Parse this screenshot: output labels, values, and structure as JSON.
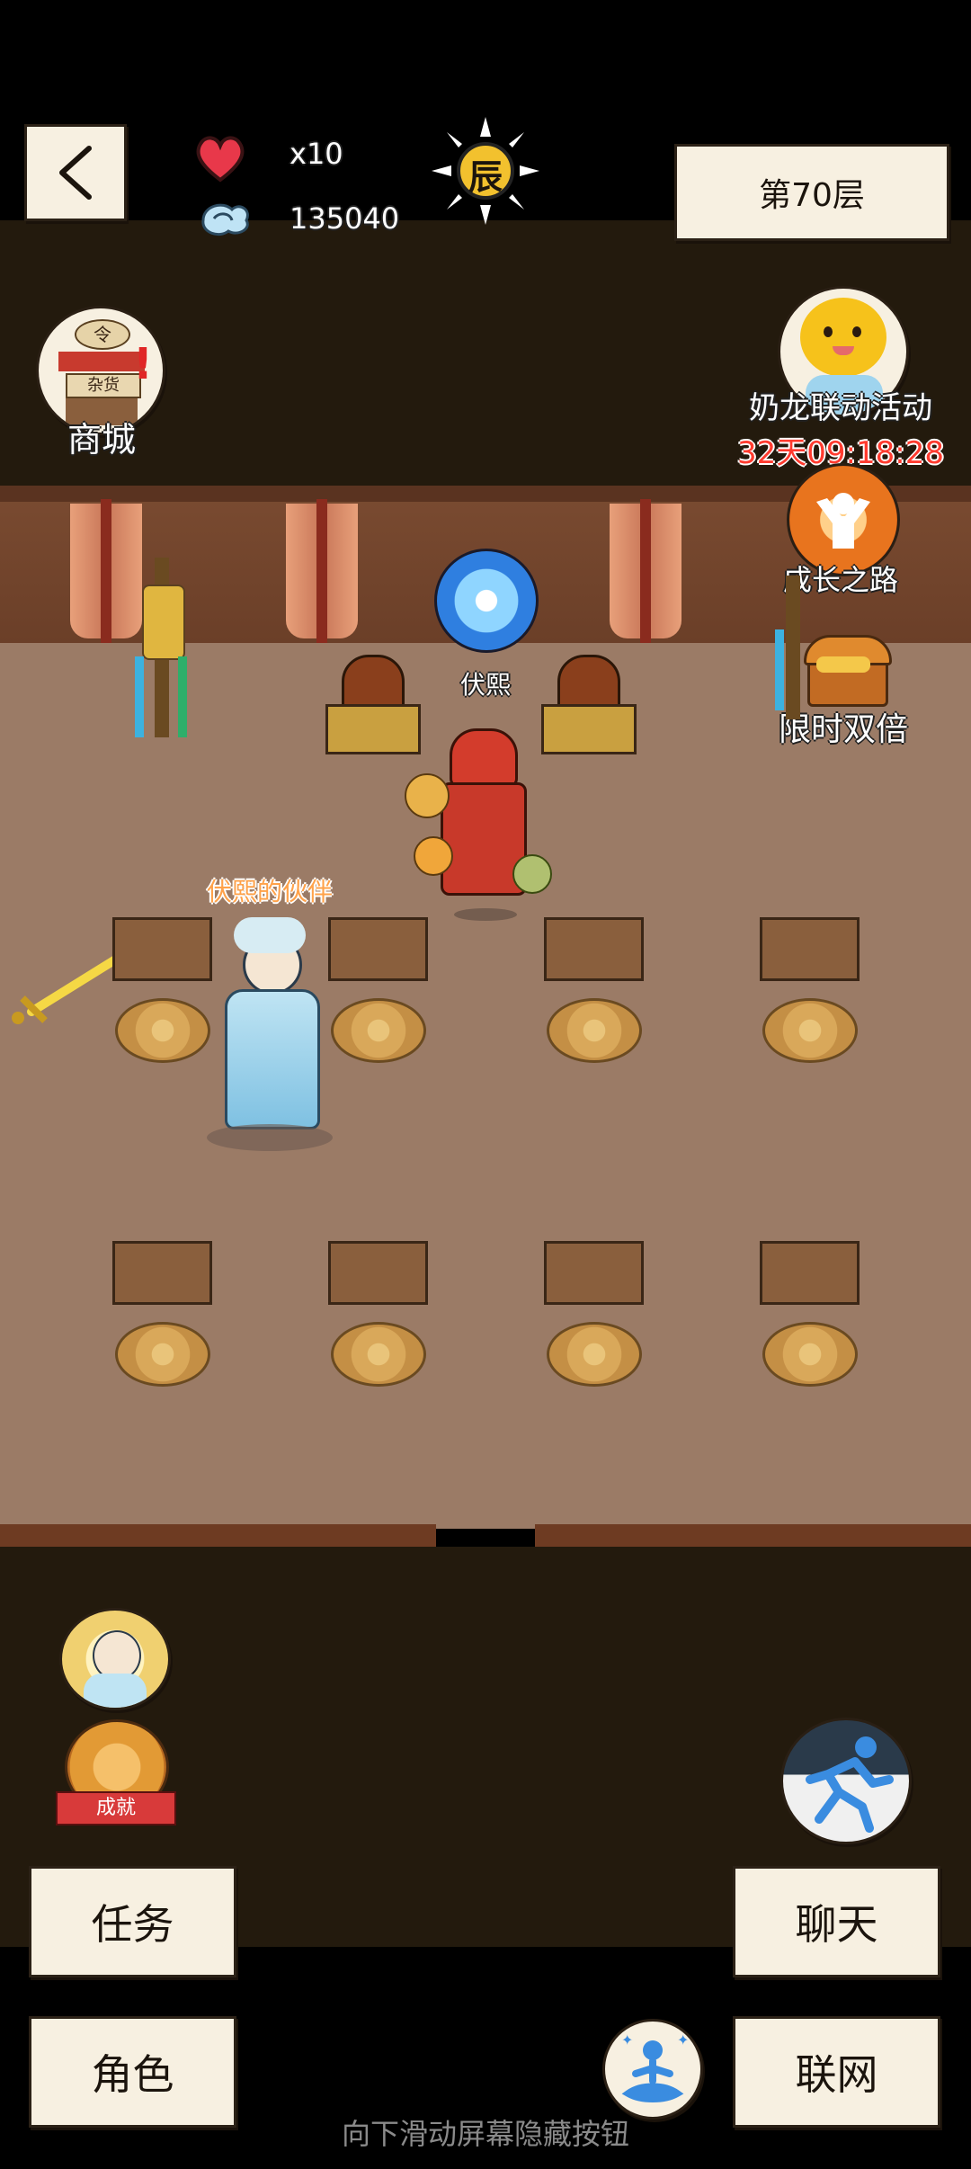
{
  "top_bar": {
    "lives_count": "x10",
    "currency_value": "135040",
    "time_glyph": "辰",
    "floor_label": "第70层"
  },
  "side_menu": {
    "shop_label": "商城",
    "shop_sign_top": "令",
    "shop_sign_text": "杂货",
    "event_label": "奶龙联动活动",
    "event_timer": "32天09:18:28",
    "growth_label": "成长之路",
    "double_label": "限时双倍"
  },
  "scene": {
    "npc_name": "伏熙",
    "partner_name": "伏熙的伙伴"
  },
  "bottom": {
    "achievement_badge": "成就",
    "tasks_button": "任务",
    "chat_button": "聊天",
    "role_button": "角色",
    "network_button": "联网",
    "hint_text": "向下滑动屏幕隐藏按钮"
  },
  "colors": {
    "wall": "#7a4b31",
    "floor": "#9b7b66",
    "dark_band": "#231a0d",
    "paper": "#f7f0e1",
    "timer_red": "#ff3b2f"
  },
  "icons": [
    "back-arrow-icon",
    "heart-icon",
    "spirit-cloud-icon",
    "sun-time-icon",
    "shop-icon",
    "event-mascot-icon",
    "growth-icon",
    "double-chest-icon",
    "portal-icon",
    "character-avatar-icon",
    "achievement-icon",
    "sprint-icon",
    "meditate-icon"
  ]
}
